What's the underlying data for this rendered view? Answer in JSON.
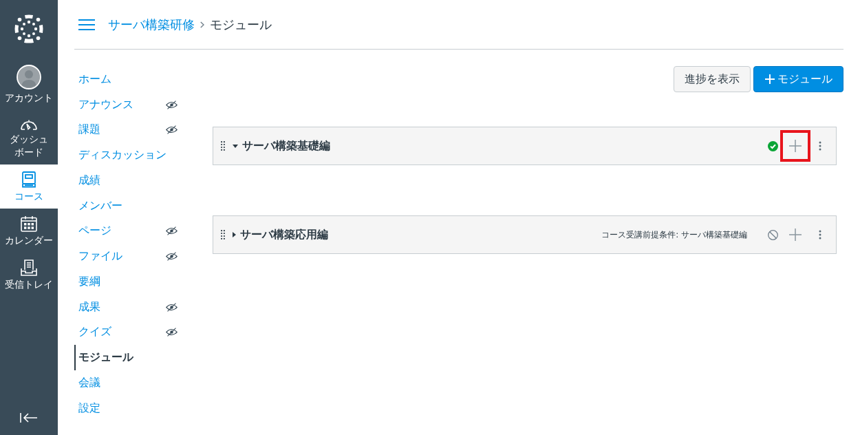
{
  "global_nav": {
    "items": [
      {
        "kind": "account",
        "label": "アカウント",
        "selected": false
      },
      {
        "kind": "dashboard",
        "label": "ダッシュボード",
        "selected": false
      },
      {
        "kind": "courses",
        "label": "コース",
        "selected": true
      },
      {
        "kind": "calendar",
        "label": "カレンダー",
        "selected": false
      },
      {
        "kind": "inbox",
        "label": "受信トレイ",
        "selected": false
      }
    ]
  },
  "breadcrumb": [
    {
      "kind": "link",
      "label": "サーバ構築研修"
    },
    {
      "kind": "current",
      "label": "モジュール"
    }
  ],
  "course_nav": [
    {
      "label": "ホーム",
      "hidden": false,
      "selected": false
    },
    {
      "label": "アナウンス",
      "hidden": true,
      "selected": false
    },
    {
      "label": "課題",
      "hidden": true,
      "selected": false
    },
    {
      "label": "ディスカッション",
      "hidden": false,
      "selected": false
    },
    {
      "label": "成績",
      "hidden": false,
      "selected": false
    },
    {
      "label": "メンバー",
      "hidden": false,
      "selected": false
    },
    {
      "label": "ページ",
      "hidden": true,
      "selected": false
    },
    {
      "label": "ファイル",
      "hidden": true,
      "selected": false
    },
    {
      "label": "要綱",
      "hidden": false,
      "selected": false
    },
    {
      "label": "成果",
      "hidden": true,
      "selected": false
    },
    {
      "label": "クイズ",
      "hidden": true,
      "selected": false
    },
    {
      "label": "モジュール",
      "hidden": false,
      "selected": true
    },
    {
      "label": "会議",
      "hidden": false,
      "selected": false
    },
    {
      "label": "設定",
      "hidden": false,
      "selected": false
    }
  ],
  "toolbar": {
    "buttons": [
      {
        "kind": "secondary",
        "label": "進捗を表示"
      },
      {
        "kind": "primary",
        "label": "モジュール"
      }
    ]
  },
  "modules": [
    {
      "title": "サーバ構築基礎編",
      "expanded": true,
      "completed": true,
      "locked": false,
      "add_highlighted": true
    },
    {
      "title": "サーバ構築応用編",
      "expanded": false,
      "completed": false,
      "locked": true,
      "prerequisite": "コース受講前提条件: サーバ構築基礎編",
      "add_highlighted": false
    }
  ]
}
